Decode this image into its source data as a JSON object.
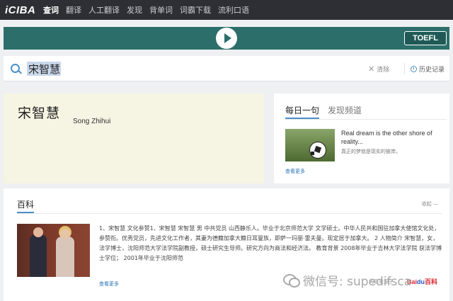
{
  "nav": {
    "logo": "iCIBA",
    "items": [
      {
        "label": "查词",
        "active": true
      },
      {
        "label": "翻译",
        "active": false
      },
      {
        "label": "人工翻译",
        "active": false
      },
      {
        "label": "发现",
        "active": false
      },
      {
        "label": "背单词",
        "active": false
      },
      {
        "label": "词霸下载",
        "active": false
      },
      {
        "label": "流利口语",
        "active": false
      }
    ]
  },
  "banner": {
    "badge": "TOEFL",
    "play_icon": "play-icon"
  },
  "search": {
    "value": "宋智慧",
    "clear_label": "清除",
    "history_label": "历史记录"
  },
  "word": {
    "title": "宋智慧",
    "pinyin": "Song Zhihui"
  },
  "daily": {
    "tab_active": "每日一句",
    "tab_other": "发现频道",
    "sentence_en": "Real dream is the other shore of reality...",
    "sentence_cn": "真正的梦就是现实的彼岸。",
    "more": "查看更多"
  },
  "baike": {
    "title": "百科",
    "collapse": "收起 —",
    "text": "1、宋智慧 文化参赞1、宋智慧 宋智慧 男 中共党员 山西静乐人。毕业于北京师范大学 文学硕士。中华人民共和国驻加拿大使馆文化处，参赞衔。优秀党员，先进文化工作者，其妻为德籍加拿大籍日耳曼族，即萨一玛丽·雷夫曼。现定居于加拿大。 2 人物简介 宋智慧，女，法学博士，沈阳师范大学法学院副教授，硕士研究生导师。研究方向为商法和经济法。 教育背景 2008年毕业于吉林大学法学院 获法学博士学位； 2001年毕业于沈阳师范",
    "more": "查看更多",
    "source": "内容来源于",
    "source_logo_a": "Bai",
    "source_logo_b": "du",
    "source_logo_c": "百科"
  },
  "watermark": {
    "text": "微信号: supedifsca"
  }
}
